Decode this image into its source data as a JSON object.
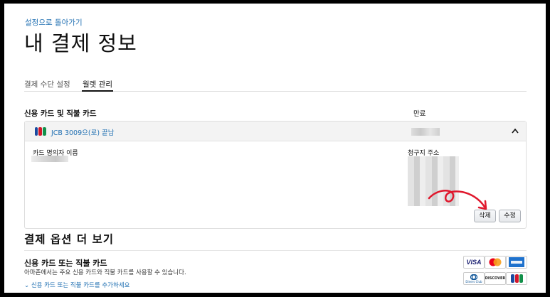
{
  "nav": {
    "back_link": "설정으로 돌아가기"
  },
  "page": {
    "title": "내 결제 정보"
  },
  "tabs": [
    {
      "label": "결제 수단 설정",
      "active": false
    },
    {
      "label": "월렛 관리",
      "active": true
    }
  ],
  "cards_section": {
    "heading": "신용 카드 및 직불 카드",
    "expiry_heading": "만료",
    "card": {
      "network_icon": "jcb-logo",
      "name": "JCB 3009으(로) 끝남",
      "holder_label": "카드 명의자 이름",
      "billing_label": "청구지 주소",
      "delete_label": "삭제",
      "edit_label": "수정"
    }
  },
  "more_options": {
    "heading": "결제 옵션 더 보기",
    "card_title": "신용 카드 또는 직불 카드",
    "card_desc": "아마존에서는 주요 신용 카드와 직불 카드를 사용할 수 있습니다.",
    "add_link": "신용 카드 또는 직불 카드를 추가하세요",
    "logos": [
      "visa",
      "mastercard",
      "amex",
      "diners-club",
      "discover",
      "jcb"
    ],
    "logo_texts": {
      "visa": "VISA",
      "discover": "DISCOVER",
      "diners": "Diners Club"
    }
  },
  "colors": {
    "link": "#1f6fb2",
    "annotation": "#e0182d"
  }
}
